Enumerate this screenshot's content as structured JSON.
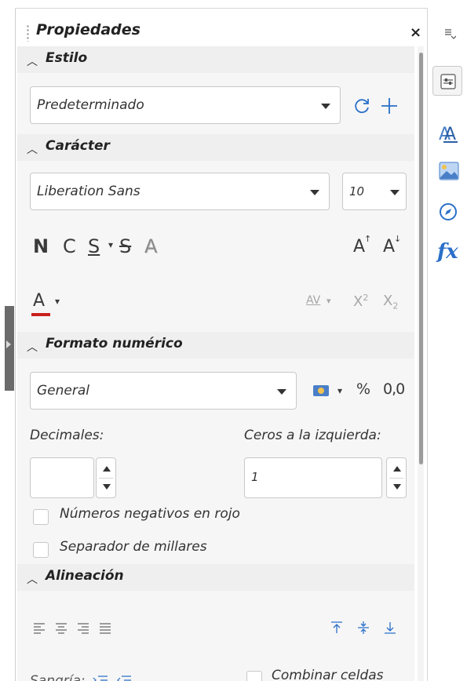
{
  "sidebar": {
    "title": "Propiedades",
    "close_symbol": "×",
    "menu_icon": "sidebar-menu-icon"
  },
  "styles": {
    "header": "Estilo",
    "current_style": "Predeterminado",
    "update_icon": "update-style-icon",
    "new_icon": "new-style-icon"
  },
  "character": {
    "header": "Carácter",
    "font_name": "Liberation Sans",
    "font_size": "10",
    "bold": "N",
    "italic": "C",
    "underline": "S",
    "strikethrough": "S",
    "shadow": "A",
    "grow": "A",
    "shrink": "A",
    "font_color": "A",
    "font_color_swatch": "#c9211e",
    "spacing": "AV",
    "superscript": "X",
    "superscript_exp": "2",
    "subscript": "X",
    "subscript_exp": "2"
  },
  "number_format": {
    "header": "Formato numérico",
    "category": "General",
    "percent": "%",
    "decimal": "0,0",
    "decimals_label": "Decimales:",
    "decimals_value": "",
    "leading_zeros_label": "Ceros a la izquierda:",
    "leading_zeros_value": "1",
    "negative_red_label": "Números negativos en rojo",
    "thousands_sep_label": "Separador de millares"
  },
  "alignment": {
    "header": "Alineación",
    "indent_label": "Sangría:",
    "merge_label": "Combinar celdas"
  },
  "deck": {
    "items": [
      "properties-icon",
      "styles-icon",
      "gallery-icon",
      "navigator-icon",
      "functions-icon"
    ],
    "functions_text": "fx"
  },
  "colors": {
    "accent_blue": "#2a6fc9",
    "section_header_bg": "#efefef",
    "section_body_bg": "#f6f6f6",
    "font_color_red": "#c9211e"
  }
}
